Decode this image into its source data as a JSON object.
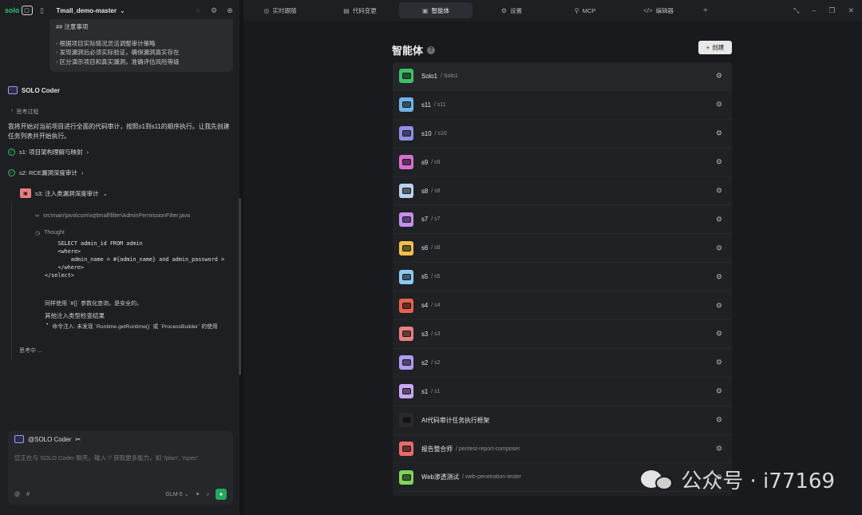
{
  "app": {
    "logo_text": "solo",
    "project": "Tmall_demo-master"
  },
  "notes": {
    "heading": "## 注意事项",
    "items": [
      "- 根据项目实际情况灵活调整审计策略",
      "- 发现漏洞后必须实际验证，确保漏洞真实存在",
      "- 区分演示项目和真实漏洞，准确评估风险等级"
    ]
  },
  "chat": {
    "agent_name": "SOLO Coder",
    "think_label": "思考过程",
    "intro": "我将开始对当前项目进行全面的代码审计，按照s1到s11的顺序执行。让我先创建任务列表并开始执行。",
    "steps": [
      {
        "label": "s1: 项目架构理解与映射"
      },
      {
        "label": "s2: RCE漏洞深度审计"
      }
    ],
    "s3": {
      "badge": "s3",
      "label": "s3: 注入类漏洞深度审计"
    },
    "file": "src\\main\\java\\com\\xq\\tmall\\filter\\AdminPermissionFilter.java",
    "thought": "Thought",
    "code": "    SELECT admin_id FROM admin\n    <where>\n        admin_name = #{admin_name} and admin_password =\n    </where>\n</select>",
    "note1": "同样使用 `#{}` 参数化查询，是安全的。",
    "note2": "其他注入类型检查结果",
    "note3": "命令注入: 未发现 `Runtime.getRuntime()` 或 `ProcessBuilder` 的使用",
    "thinking": "思考中 ..."
  },
  "input": {
    "mention": "@SOLO Coder",
    "placeholder": "您正在与 SOLO Coder 聊天。输入 '/' 获取更多能力，如 '/plan', '/spec'",
    "model": "GLM-5"
  },
  "tabs": [
    {
      "label": "实时跟随",
      "icon": "◎"
    },
    {
      "label": "代码变更",
      "icon": "▤"
    },
    {
      "label": "智能体",
      "icon": "▣"
    },
    {
      "label": "设置",
      "icon": "⚙"
    },
    {
      "label": "MCP",
      "icon": "⚲"
    },
    {
      "label": "编辑器",
      "icon": "</>"
    }
  ],
  "page": {
    "title": "智能体",
    "create_label": "创建"
  },
  "agents": [
    {
      "name": "Solo1",
      "slug": "/ Solo1",
      "color": "#3fbf6a"
    },
    {
      "name": "s11",
      "slug": "/ s11",
      "color": "#6fb3e8"
    },
    {
      "name": "s10",
      "slug": "/ s10",
      "color": "#8f8fe6"
    },
    {
      "name": "s9",
      "slug": "/ s9",
      "color": "#d46fd0"
    },
    {
      "name": "s8",
      "slug": "/ s8",
      "color": "#b9d3ee"
    },
    {
      "name": "s7",
      "slug": "/ s7",
      "color": "#c58ef0"
    },
    {
      "name": "s6",
      "slug": "/ s6",
      "color": "#f0c04f"
    },
    {
      "name": "s5",
      "slug": "/ s5",
      "color": "#8ecbf0"
    },
    {
      "name": "s4",
      "slug": "/ s4",
      "color": "#e8604c"
    },
    {
      "name": "s3",
      "slug": "/ s3",
      "color": "#e88080"
    },
    {
      "name": "s2",
      "slug": "/ s2",
      "color": "#b29af0"
    },
    {
      "name": "s1",
      "slug": "/ s1",
      "color": "#c9a8f5"
    },
    {
      "name": "AI代码审计任务执行框架",
      "slug": "",
      "color": "#2a2a2a"
    },
    {
      "name": "报告整合师",
      "slug": "/ pentest-report-composer",
      "color": "#e86a6a"
    },
    {
      "name": "Web渗透测试",
      "slug": "/ web-penetration-tester",
      "color": "#7ed35a"
    }
  ],
  "watermark": {
    "text": "公众号 · i77169"
  }
}
